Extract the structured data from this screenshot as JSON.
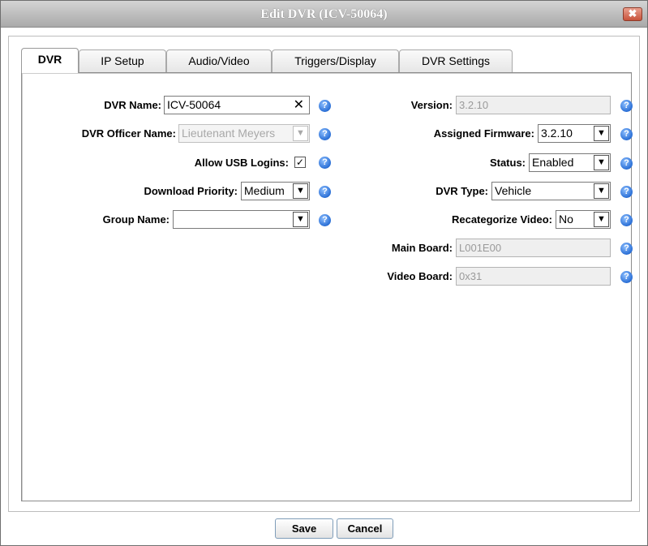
{
  "window": {
    "title": "Edit DVR (ICV-50064)",
    "close_glyph": "✖"
  },
  "tabs": [
    {
      "label": "DVR",
      "active": true
    },
    {
      "label": "IP Setup",
      "active": false
    },
    {
      "label": "Audio/Video",
      "active": false
    },
    {
      "label": "Triggers/Display",
      "active": false
    },
    {
      "label": "DVR Settings",
      "active": false
    }
  ],
  "left": {
    "dvr_name": {
      "label": "DVR Name:",
      "value": "ICV-50064",
      "clear_glyph": "✕"
    },
    "dvr_officer_name": {
      "label": "DVR Officer Name:",
      "value": "Lieutenant Meyers"
    },
    "allow_usb_logins": {
      "label": "Allow USB Logins:",
      "checked": true,
      "check_glyph": "✓"
    },
    "download_priority": {
      "label": "Download Priority:",
      "value": "Medium"
    },
    "group_name": {
      "label": "Group Name:",
      "value": ""
    }
  },
  "right": {
    "version": {
      "label": "Version:",
      "value": "3.2.10"
    },
    "assigned_firmware": {
      "label": "Assigned Firmware:",
      "value": "3.2.10"
    },
    "status": {
      "label": "Status:",
      "value": "Enabled"
    },
    "dvr_type": {
      "label": "DVR Type:",
      "value": "Vehicle"
    },
    "recategorize_video": {
      "label": "Recategorize Video:",
      "value": "No"
    },
    "main_board": {
      "label": "Main Board:",
      "value": "L001E00"
    },
    "video_board": {
      "label": "Video Board:",
      "value": "0x31"
    }
  },
  "help_glyph": "?",
  "dropdown_glyph": "▼",
  "buttons": {
    "save": "Save",
    "cancel": "Cancel"
  },
  "colors": {
    "help_icon": "#2a6fd6",
    "titlebar": "#a9a9a9",
    "close_button": "#c8523a"
  }
}
